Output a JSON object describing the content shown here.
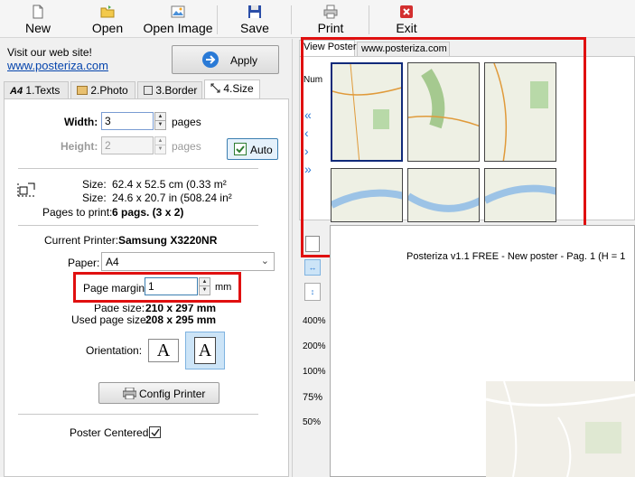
{
  "toolbar": {
    "new": "New",
    "open": "Open",
    "open_image": "Open Image",
    "save": "Save",
    "print": "Print",
    "exit": "Exit"
  },
  "left": {
    "visit_text": "Visit our web site!",
    "site_link": "www.posteriza.com",
    "apply_label": "Apply",
    "tabs": [
      "1.Texts",
      "2.Photo",
      "3.Border",
      "4.Size"
    ],
    "width_label": "Width:",
    "width_value": "3",
    "width_unit": "pages",
    "height_label": "Height:",
    "height_value": "2",
    "height_unit": "pages",
    "auto_label": "Auto",
    "size_label": "Size:",
    "size_cm": "62.4 x 52.5 cm (0.33 m²",
    "size_in": "24.6 x 20.7 in (508.24 in²",
    "pages_to_print_label": "Pages to print:",
    "pages_to_print_value": "6 pags. (3 x 2)",
    "current_printer_label": "Current Printer:",
    "current_printer_value": "Samsung X3220NR",
    "paper_label": "Paper:",
    "paper_value": "A4",
    "page_margin_label": "Page margin:",
    "page_margin_value": "1",
    "page_margin_unit": "mm",
    "page_size_label": "Page size:",
    "page_size_value": "210 x 297 mm",
    "used_page_size_label": "Used page size:",
    "used_page_size_value": "208 x 295 mm",
    "orientation_label": "Orientation:",
    "config_printer_label": "Config Printer",
    "poster_centered_label": "Poster Centered:"
  },
  "right": {
    "tabs": [
      "View Poster",
      "www.posteriza.com"
    ],
    "num_label": "Num",
    "zoom_levels": [
      "400%",
      "200%",
      "100%",
      "75%",
      "50%"
    ],
    "preview_header": "Posteriza v1.1 FREE - New poster - Pag. 1 (H = 1"
  },
  "colors": {
    "highlight": "#e01010",
    "link": "#0645ad",
    "accent_blue": "#2a7ad6"
  }
}
